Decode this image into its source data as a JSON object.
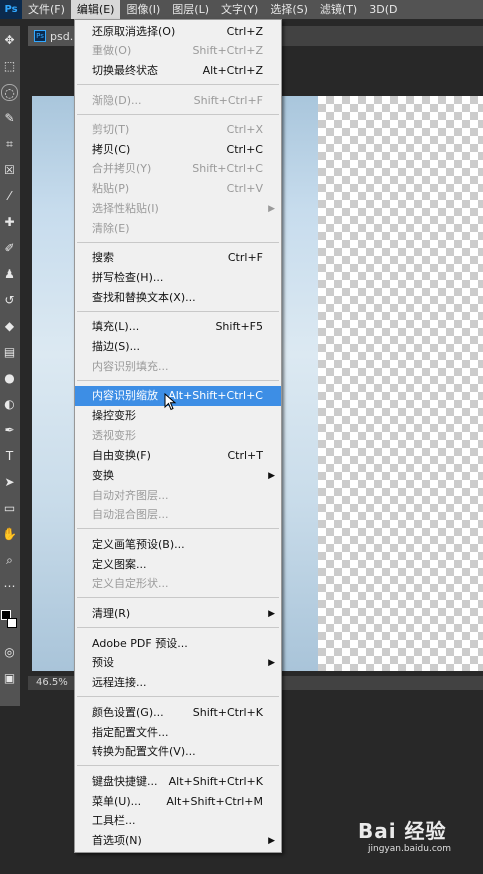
{
  "menubar": {
    "logo": "Ps",
    "items": [
      "文件(F)",
      "编辑(E)",
      "图像(I)",
      "图层(L)",
      "文字(Y)",
      "选择(S)",
      "滤镜(T)",
      "3D(D"
    ]
  },
  "document_tab": {
    "title": "psd.p"
  },
  "statusbar": {
    "zoom": "46.5%"
  },
  "edit_menu": {
    "items": [
      {
        "label": "还原取消选择(O)",
        "shortcut": "Ctrl+Z"
      },
      {
        "label": "重做(O)",
        "shortcut": "Shift+Ctrl+Z"
      },
      {
        "label": "切换最终状态",
        "shortcut": "Alt+Ctrl+Z"
      },
      {
        "label": "渐隐(D)...",
        "shortcut": "Shift+Ctrl+F"
      },
      {
        "label": "剪切(T)",
        "shortcut": "Ctrl+X"
      },
      {
        "label": "拷贝(C)",
        "shortcut": "Ctrl+C"
      },
      {
        "label": "合并拷贝(Y)",
        "shortcut": "Shift+Ctrl+C"
      },
      {
        "label": "粘贴(P)",
        "shortcut": "Ctrl+V"
      },
      {
        "label": "选择性粘贴(I)",
        "shortcut": ""
      },
      {
        "label": "清除(E)",
        "shortcut": ""
      },
      {
        "label": "搜索",
        "shortcut": "Ctrl+F"
      },
      {
        "label": "拼写检查(H)...",
        "shortcut": ""
      },
      {
        "label": "查找和替换文本(X)...",
        "shortcut": ""
      },
      {
        "label": "填充(L)...",
        "shortcut": "Shift+F5"
      },
      {
        "label": "描边(S)...",
        "shortcut": ""
      },
      {
        "label": "内容识别填充...",
        "shortcut": ""
      },
      {
        "label": "内容识别缩放",
        "shortcut": "Alt+Shift+Ctrl+C"
      },
      {
        "label": "操控变形",
        "shortcut": ""
      },
      {
        "label": "透视变形",
        "shortcut": ""
      },
      {
        "label": "自由变换(F)",
        "shortcut": "Ctrl+T"
      },
      {
        "label": "变换",
        "shortcut": ""
      },
      {
        "label": "自动对齐图层...",
        "shortcut": ""
      },
      {
        "label": "自动混合图层...",
        "shortcut": ""
      },
      {
        "label": "定义画笔预设(B)...",
        "shortcut": ""
      },
      {
        "label": "定义图案...",
        "shortcut": ""
      },
      {
        "label": "定义自定形状...",
        "shortcut": ""
      },
      {
        "label": "清理(R)",
        "shortcut": ""
      },
      {
        "label": "Adobe PDF 预设...",
        "shortcut": ""
      },
      {
        "label": "预设",
        "shortcut": ""
      },
      {
        "label": "远程连接...",
        "shortcut": ""
      },
      {
        "label": "颜色设置(G)...",
        "shortcut": "Shift+Ctrl+K"
      },
      {
        "label": "指定配置文件...",
        "shortcut": ""
      },
      {
        "label": "转换为配置文件(V)...",
        "shortcut": ""
      },
      {
        "label": "键盘快捷键...",
        "shortcut": "Alt+Shift+Ctrl+K"
      },
      {
        "label": "菜单(U)...",
        "shortcut": "Alt+Shift+Ctrl+M"
      },
      {
        "label": "工具栏...",
        "shortcut": ""
      },
      {
        "label": "首选项(N)",
        "shortcut": ""
      }
    ]
  },
  "watermark": {
    "brand": "Bai 经验",
    "url": "jingyan.baidu.com"
  },
  "colors": {
    "highlight": "#3d8ee5",
    "menu_bg": "#f0f0f0",
    "app_bg": "#282828"
  }
}
